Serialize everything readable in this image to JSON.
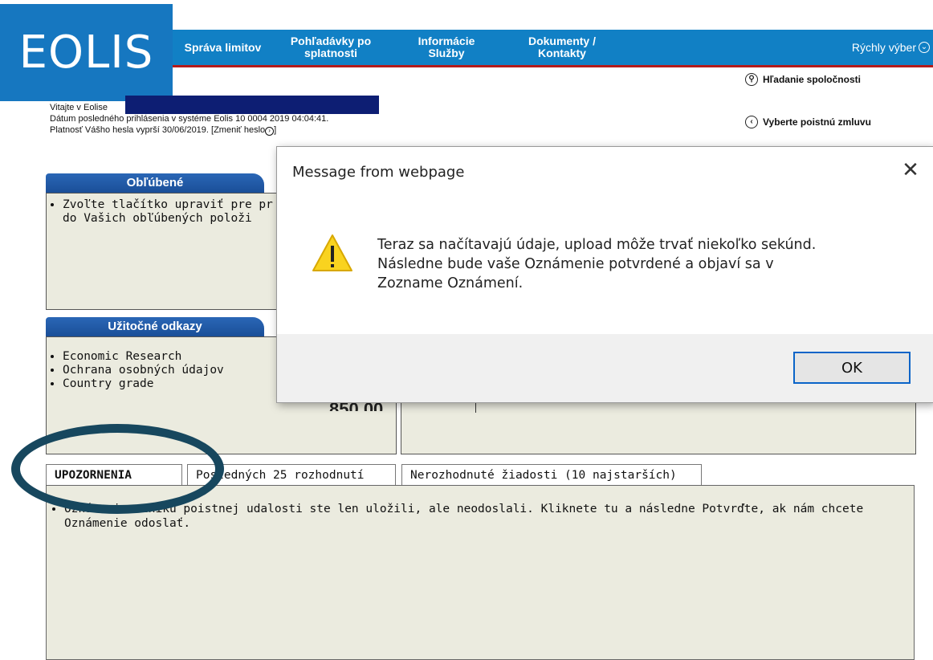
{
  "logo": {
    "text": "EOLIS"
  },
  "nav": {
    "items": [
      {
        "label": "Správa limitov"
      },
      {
        "label": "Pohľadávky po splatnosti"
      },
      {
        "label": "Informácie Služby"
      },
      {
        "label": "Dokumenty / Kontakty"
      }
    ],
    "quick_select": "Rýchly výber"
  },
  "side_links": {
    "search_company": "Hľadanie spoločnosti",
    "select_policy": "Vyberte poistnú zmluvu"
  },
  "welcome": {
    "greeting": "Vitajte v Eolise",
    "last_login": "Dátum posledného prihlásenia v systéme Eolis 10 0004 2019 04:04:41.",
    "password_expiry": "Platnosť Vášho hesla vyprší 30/06/2019. [Zmeniť heslo",
    "password_expiry_end": "]"
  },
  "favorites": {
    "title": "Obľúbené",
    "text_line1": "Zvoľte tlačítko upraviť pre pr",
    "text_line2": "do Vašich obľúbených položi"
  },
  "useful_links": {
    "title": "Užitočné odkazy",
    "items": [
      "Economic Research",
      "Ochrana osobných údajov",
      "Country grade"
    ]
  },
  "partial_value": "850 00",
  "tabs": [
    {
      "label": "UPOZORNENIA"
    },
    {
      "label": "Posledných 25 rozhodnutí"
    },
    {
      "label": "Nerozhodnuté žiadosti (10 najstarších)"
    }
  ],
  "notices": {
    "items": [
      "Oznámenie vzniku poistnej udalosti ste len uložili, ale neodoslali. Kliknete tu a následne Potvrďte, ak nám chcete Oznámenie odoslať."
    ]
  },
  "dialog": {
    "title": "Message from webpage",
    "message_line1": "Teraz sa načítavajú údaje, upload môže trvať niekoľko sekúnd.",
    "message_line2": "Následne bude vaše Oznámenie potvrdené a objaví sa v",
    "message_line3": "Zozname Oznámení.",
    "ok_label": "OK"
  },
  "colors": {
    "brand_blue": "#1677c0",
    "nav_blue": "#1180c5",
    "accent_red": "#b31b1b",
    "panel_bg": "#ebebdf",
    "highlight_ring": "#17475e"
  }
}
